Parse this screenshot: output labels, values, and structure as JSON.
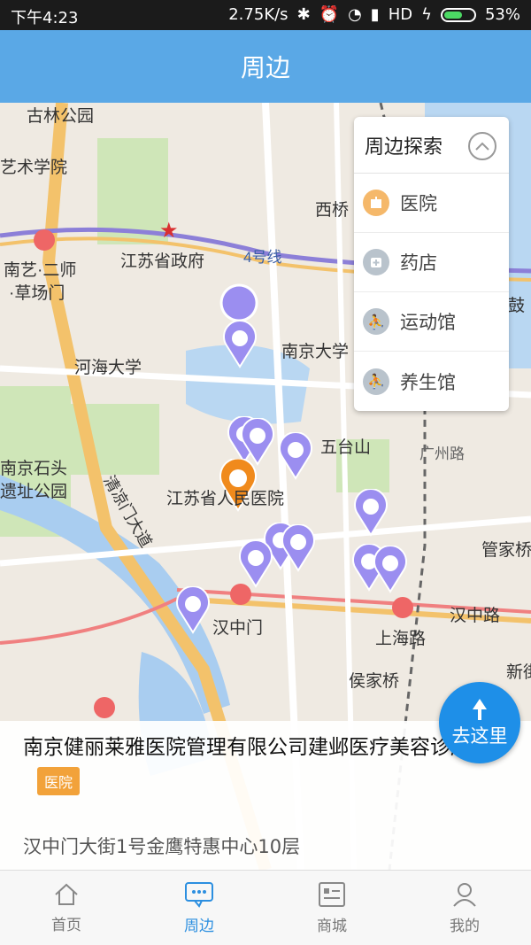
{
  "status_bar": {
    "time": "下午4:23",
    "network_speed": "2.75K/s",
    "hd": "HD",
    "battery": "53%"
  },
  "header": {
    "title": "周边"
  },
  "map": {
    "labels": [
      {
        "text": "古林公园"
      },
      {
        "text": "艺术学院"
      },
      {
        "text": "西桥"
      },
      {
        "text": "江苏省政府"
      },
      {
        "text": "4号线"
      },
      {
        "text": "南艺·二师"
      },
      {
        "text": "·草场门"
      },
      {
        "text": "河海大学"
      },
      {
        "text": "南京大学"
      },
      {
        "text": "五台山"
      },
      {
        "text": "广州路"
      },
      {
        "text": "南京石头"
      },
      {
        "text": "遗址公园"
      },
      {
        "text": "江苏省人民医院"
      },
      {
        "text": "清凉门大道"
      },
      {
        "text": "管家桥"
      },
      {
        "text": "汉中门"
      },
      {
        "text": "汉中路"
      },
      {
        "text": "上海路"
      },
      {
        "text": "侯家桥"
      },
      {
        "text": "新街"
      },
      {
        "text": "鼓"
      }
    ]
  },
  "explore": {
    "title": "周边探索",
    "items": [
      {
        "label": "医院",
        "icon": "hospital-icon",
        "color": "#f5b86a"
      },
      {
        "label": "药店",
        "icon": "pharmacy-icon",
        "color": "#b9c3cc"
      },
      {
        "label": "运动馆",
        "icon": "sports-icon",
        "color": "#b9c3cc"
      },
      {
        "label": "养生馆",
        "icon": "wellness-icon",
        "color": "#b9c3cc"
      }
    ]
  },
  "go_button": {
    "label": "去这里"
  },
  "info_card": {
    "name": "南京健丽莱雅医院管理有限公司建邺医疗美容诊所",
    "tag": "医院",
    "address": "汉中门大街1号金鹰特惠中心10层"
  },
  "bottom_nav": [
    {
      "label": "首页",
      "icon": "home-icon",
      "active": false
    },
    {
      "label": "周边",
      "icon": "nearby-chat-icon",
      "active": true
    },
    {
      "label": "商城",
      "icon": "mall-icon",
      "active": false
    },
    {
      "label": "我的",
      "icon": "user-icon",
      "active": false
    }
  ],
  "colors": {
    "header": "#5aa8e6",
    "marker_purple": "#9b8ef0",
    "marker_orange": "#f08a1c",
    "accent_blue": "#1e8fe8"
  }
}
